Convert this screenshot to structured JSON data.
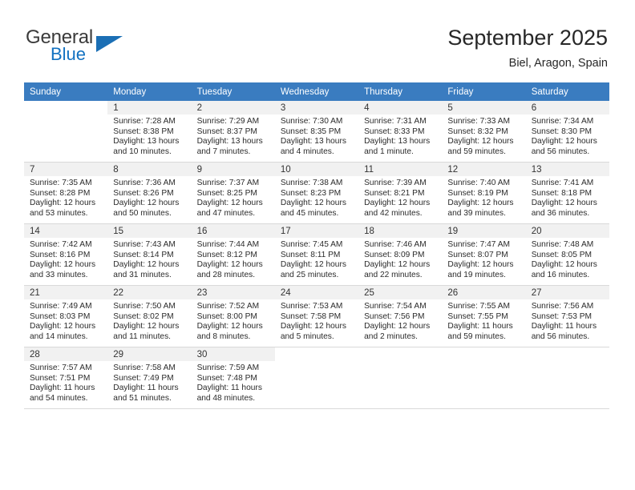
{
  "brand": {
    "name_part1": "General",
    "name_part2": "Blue",
    "triangle_color": "#1b6fb5"
  },
  "header": {
    "title": "September 2025",
    "subtitle": "Biel, Aragon, Spain"
  },
  "theme": {
    "header_row_color": "#3a7cc0",
    "daynum_bar_color": "#f1f1f1",
    "grid_line_color": "#d9d9d9"
  },
  "weekdays": [
    "Sunday",
    "Monday",
    "Tuesday",
    "Wednesday",
    "Thursday",
    "Friday",
    "Saturday"
  ],
  "labels": {
    "sunrise_prefix": "Sunrise:",
    "sunset_prefix": "Sunset:",
    "daylight_prefix": "Daylight:"
  },
  "weeks": [
    [
      {
        "day": "",
        "lines": []
      },
      {
        "day": "1",
        "lines": [
          "Sunrise: 7:28 AM",
          "Sunset: 8:38 PM",
          "Daylight: 13 hours",
          "and 10 minutes."
        ]
      },
      {
        "day": "2",
        "lines": [
          "Sunrise: 7:29 AM",
          "Sunset: 8:37 PM",
          "Daylight: 13 hours",
          "and 7 minutes."
        ]
      },
      {
        "day": "3",
        "lines": [
          "Sunrise: 7:30 AM",
          "Sunset: 8:35 PM",
          "Daylight: 13 hours",
          "and 4 minutes."
        ]
      },
      {
        "day": "4",
        "lines": [
          "Sunrise: 7:31 AM",
          "Sunset: 8:33 PM",
          "Daylight: 13 hours",
          "and 1 minute."
        ]
      },
      {
        "day": "5",
        "lines": [
          "Sunrise: 7:33 AM",
          "Sunset: 8:32 PM",
          "Daylight: 12 hours",
          "and 59 minutes."
        ]
      },
      {
        "day": "6",
        "lines": [
          "Sunrise: 7:34 AM",
          "Sunset: 8:30 PM",
          "Daylight: 12 hours",
          "and 56 minutes."
        ]
      }
    ],
    [
      {
        "day": "7",
        "lines": [
          "Sunrise: 7:35 AM",
          "Sunset: 8:28 PM",
          "Daylight: 12 hours",
          "and 53 minutes."
        ]
      },
      {
        "day": "8",
        "lines": [
          "Sunrise: 7:36 AM",
          "Sunset: 8:26 PM",
          "Daylight: 12 hours",
          "and 50 minutes."
        ]
      },
      {
        "day": "9",
        "lines": [
          "Sunrise: 7:37 AM",
          "Sunset: 8:25 PM",
          "Daylight: 12 hours",
          "and 47 minutes."
        ]
      },
      {
        "day": "10",
        "lines": [
          "Sunrise: 7:38 AM",
          "Sunset: 8:23 PM",
          "Daylight: 12 hours",
          "and 45 minutes."
        ]
      },
      {
        "day": "11",
        "lines": [
          "Sunrise: 7:39 AM",
          "Sunset: 8:21 PM",
          "Daylight: 12 hours",
          "and 42 minutes."
        ]
      },
      {
        "day": "12",
        "lines": [
          "Sunrise: 7:40 AM",
          "Sunset: 8:19 PM",
          "Daylight: 12 hours",
          "and 39 minutes."
        ]
      },
      {
        "day": "13",
        "lines": [
          "Sunrise: 7:41 AM",
          "Sunset: 8:18 PM",
          "Daylight: 12 hours",
          "and 36 minutes."
        ]
      }
    ],
    [
      {
        "day": "14",
        "lines": [
          "Sunrise: 7:42 AM",
          "Sunset: 8:16 PM",
          "Daylight: 12 hours",
          "and 33 minutes."
        ]
      },
      {
        "day": "15",
        "lines": [
          "Sunrise: 7:43 AM",
          "Sunset: 8:14 PM",
          "Daylight: 12 hours",
          "and 31 minutes."
        ]
      },
      {
        "day": "16",
        "lines": [
          "Sunrise: 7:44 AM",
          "Sunset: 8:12 PM",
          "Daylight: 12 hours",
          "and 28 minutes."
        ]
      },
      {
        "day": "17",
        "lines": [
          "Sunrise: 7:45 AM",
          "Sunset: 8:11 PM",
          "Daylight: 12 hours",
          "and 25 minutes."
        ]
      },
      {
        "day": "18",
        "lines": [
          "Sunrise: 7:46 AM",
          "Sunset: 8:09 PM",
          "Daylight: 12 hours",
          "and 22 minutes."
        ]
      },
      {
        "day": "19",
        "lines": [
          "Sunrise: 7:47 AM",
          "Sunset: 8:07 PM",
          "Daylight: 12 hours",
          "and 19 minutes."
        ]
      },
      {
        "day": "20",
        "lines": [
          "Sunrise: 7:48 AM",
          "Sunset: 8:05 PM",
          "Daylight: 12 hours",
          "and 16 minutes."
        ]
      }
    ],
    [
      {
        "day": "21",
        "lines": [
          "Sunrise: 7:49 AM",
          "Sunset: 8:03 PM",
          "Daylight: 12 hours",
          "and 14 minutes."
        ]
      },
      {
        "day": "22",
        "lines": [
          "Sunrise: 7:50 AM",
          "Sunset: 8:02 PM",
          "Daylight: 12 hours",
          "and 11 minutes."
        ]
      },
      {
        "day": "23",
        "lines": [
          "Sunrise: 7:52 AM",
          "Sunset: 8:00 PM",
          "Daylight: 12 hours",
          "and 8 minutes."
        ]
      },
      {
        "day": "24",
        "lines": [
          "Sunrise: 7:53 AM",
          "Sunset: 7:58 PM",
          "Daylight: 12 hours",
          "and 5 minutes."
        ]
      },
      {
        "day": "25",
        "lines": [
          "Sunrise: 7:54 AM",
          "Sunset: 7:56 PM",
          "Daylight: 12 hours",
          "and 2 minutes."
        ]
      },
      {
        "day": "26",
        "lines": [
          "Sunrise: 7:55 AM",
          "Sunset: 7:55 PM",
          "Daylight: 11 hours",
          "and 59 minutes."
        ]
      },
      {
        "day": "27",
        "lines": [
          "Sunrise: 7:56 AM",
          "Sunset: 7:53 PM",
          "Daylight: 11 hours",
          "and 56 minutes."
        ]
      }
    ],
    [
      {
        "day": "28",
        "lines": [
          "Sunrise: 7:57 AM",
          "Sunset: 7:51 PM",
          "Daylight: 11 hours",
          "and 54 minutes."
        ]
      },
      {
        "day": "29",
        "lines": [
          "Sunrise: 7:58 AM",
          "Sunset: 7:49 PM",
          "Daylight: 11 hours",
          "and 51 minutes."
        ]
      },
      {
        "day": "30",
        "lines": [
          "Sunrise: 7:59 AM",
          "Sunset: 7:48 PM",
          "Daylight: 11 hours",
          "and 48 minutes."
        ]
      },
      {
        "day": "",
        "lines": []
      },
      {
        "day": "",
        "lines": []
      },
      {
        "day": "",
        "lines": []
      },
      {
        "day": "",
        "lines": []
      }
    ]
  ]
}
